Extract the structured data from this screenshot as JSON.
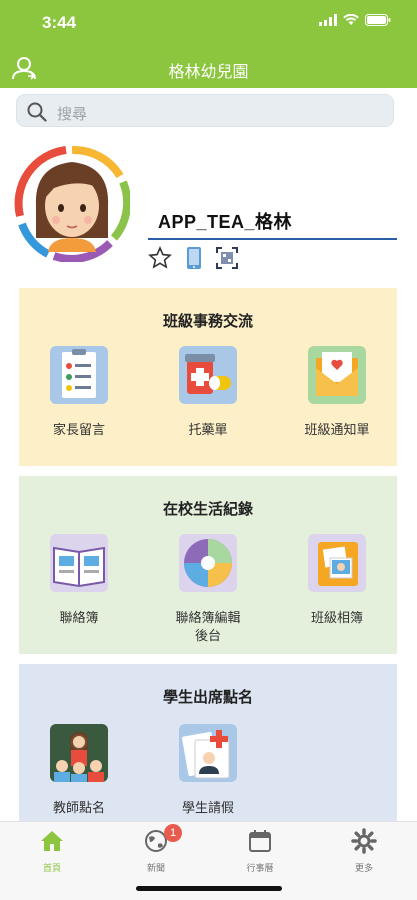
{
  "status_bar": {
    "time": "3:44"
  },
  "header": {
    "title": "格林幼兒園"
  },
  "search": {
    "placeholder": "搜尋"
  },
  "profile": {
    "name": "APP_TEA_格林"
  },
  "sections": [
    {
      "title": "班級事務交流",
      "tiles": [
        "家長留言",
        "托藥單",
        "班級通知單"
      ]
    },
    {
      "title": "在校生活紀錄",
      "tiles": [
        "聯絡簿",
        "聯絡簿編輯後台",
        "班級相簿"
      ]
    },
    {
      "title": "學生出席點名",
      "tiles": [
        "教師點名",
        "學生請假"
      ]
    }
  ],
  "tabbar": {
    "tabs": [
      {
        "label": "首頁",
        "icon": "home-icon",
        "active": true
      },
      {
        "label": "新聞",
        "icon": "globe-icon",
        "badge": "1"
      },
      {
        "label": "行事曆",
        "icon": "calendar-icon"
      },
      {
        "label": "更多",
        "icon": "gear-icon"
      }
    ]
  },
  "colors": {
    "header": "#8cc63f",
    "section1": "#fdf0c8",
    "section2": "#e4f0dc",
    "section3": "#dde5f2",
    "badge": "#e85c50"
  }
}
